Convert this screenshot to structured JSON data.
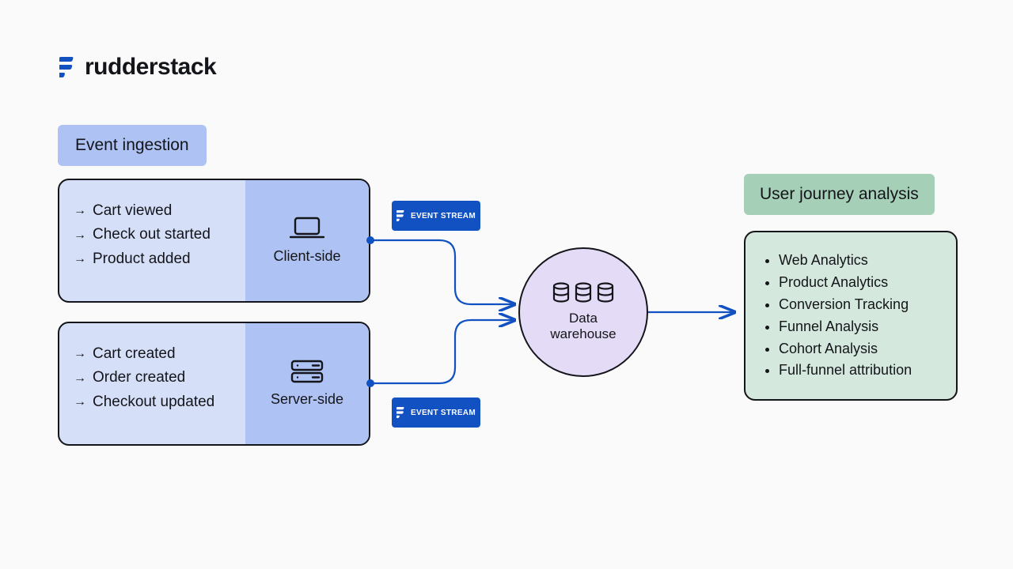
{
  "brand": {
    "name": "rudderstack",
    "accent": "#1151C2"
  },
  "ingestion": {
    "label": "Event ingestion",
    "client": {
      "title": "Client-side",
      "events": [
        "Cart viewed",
        "Check out started",
        "Product added"
      ]
    },
    "server": {
      "title": "Server-side",
      "events": [
        "Cart created",
        "Order created",
        "Checkout updated"
      ]
    },
    "stream_label": "EVENT STREAM"
  },
  "warehouse": {
    "label": "Data\nwarehouse"
  },
  "journey": {
    "label": "User journey analysis",
    "items": [
      "Web Analytics",
      "Product Analytics",
      "Conversion Tracking",
      "Funnel Analysis",
      "Cohort Analysis",
      "Full-funnel attribution"
    ]
  }
}
